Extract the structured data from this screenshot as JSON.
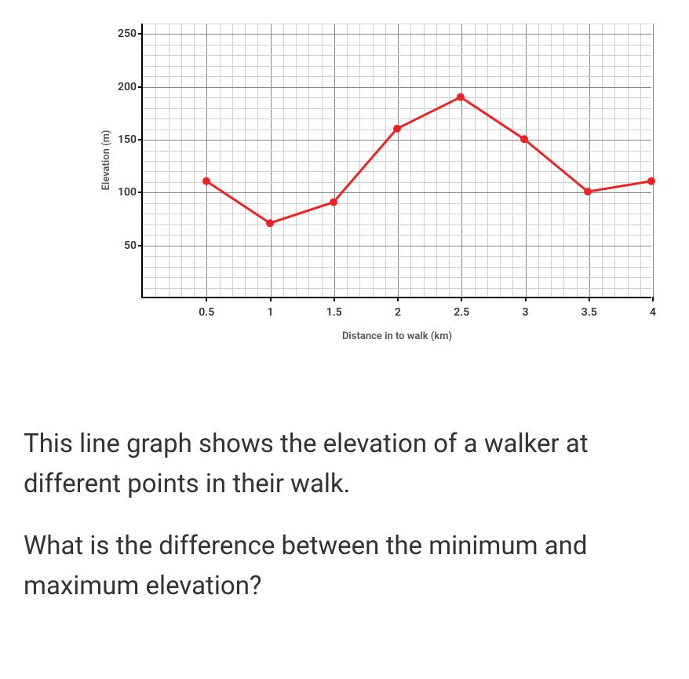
{
  "chart_data": {
    "type": "line",
    "x": [
      0.5,
      1,
      1.5,
      2,
      2.5,
      3,
      3.5,
      4
    ],
    "values": [
      110,
      70,
      90,
      160,
      190,
      150,
      100,
      110
    ],
    "xlabel": "Distance in to walk (km)",
    "ylabel": "Elevation (m)",
    "xlim": [
      0,
      4
    ],
    "ylim": [
      0,
      260
    ],
    "x_ticks": [
      0.5,
      1,
      1.5,
      2,
      2.5,
      3,
      3.5,
      4
    ],
    "y_ticks": [
      50,
      100,
      150,
      200,
      250
    ],
    "x_minor_step": 0.1,
    "y_minor_step": 10,
    "line_color": "#ee2222",
    "point_color": "#ee2222"
  },
  "question": {
    "p1": "This line graph shows the elevation of a walker at different points in their walk.",
    "p2": "What is the difference between the minimum and maximum elevation?"
  }
}
